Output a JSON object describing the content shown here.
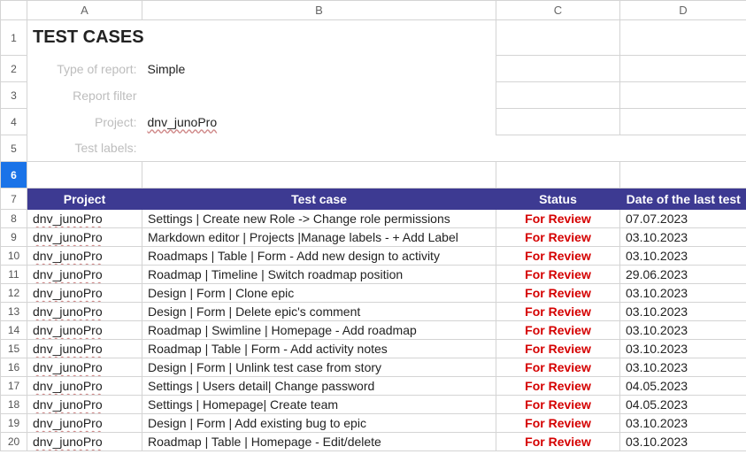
{
  "columns": [
    "A",
    "B",
    "C",
    "D"
  ],
  "top": {
    "title": "TEST CASES",
    "labels": {
      "type_of_report": "Type of report:",
      "report_filter": "Report filter",
      "project": "Project:",
      "test_labels": "Test labels:"
    },
    "values": {
      "type_of_report": "Simple",
      "report_filter": "",
      "project": "dnv_junoPro",
      "test_labels": ""
    }
  },
  "selected_row": 6,
  "table": {
    "headers": {
      "project": "Project",
      "test_case": "Test case",
      "status": "Status",
      "date": "Date of the last test"
    },
    "rows": [
      {
        "n": 8,
        "project": "dnv_junoPro",
        "test_case": "Settings | Create new Role -> Change role permissions",
        "status": "For Review",
        "date": "07.07.2023"
      },
      {
        "n": 9,
        "project": "dnv_junoPro",
        "test_case": "Markdown editor | Projects |Manage labels - + Add Label",
        "status": "For Review",
        "date": "03.10.2023"
      },
      {
        "n": 10,
        "project": "dnv_junoPro",
        "test_case": "Roadmaps | Table | Form - Add new  design  to activity",
        "status": "For Review",
        "date": "03.10.2023"
      },
      {
        "n": 11,
        "project": "dnv_junoPro",
        "test_case": "Roadmap | Timeline | Switch roadmap position",
        "status": "For Review",
        "date": "29.06.2023"
      },
      {
        "n": 12,
        "project": "dnv_junoPro",
        "test_case": "Design  | Form | Clone epic",
        "status": "For Review",
        "date": "03.10.2023"
      },
      {
        "n": 13,
        "project": "dnv_junoPro",
        "test_case": "Design  | Form | Delete epic's comment",
        "status": "For Review",
        "date": "03.10.2023"
      },
      {
        "n": 14,
        "project": "dnv_junoPro",
        "test_case": "Roadmap | Swimline | Homepage - Add roadmap",
        "status": "For Review",
        "date": "03.10.2023"
      },
      {
        "n": 15,
        "project": "dnv_junoPro",
        "test_case": "Roadmap | Table | Form - Add  activity notes",
        "status": "For Review",
        "date": "03.10.2023"
      },
      {
        "n": 16,
        "project": "dnv_junoPro",
        "test_case": "Design  | Form |  Unlink test case from story",
        "status": "For Review",
        "date": "03.10.2023"
      },
      {
        "n": 17,
        "project": "dnv_junoPro",
        "test_case": "Settings | Users detail| Change password",
        "status": "For Review",
        "date": "04.05.2023"
      },
      {
        "n": 18,
        "project": "dnv_junoPro",
        "test_case": "Settings | Homepage| Create team",
        "status": "For Review",
        "date": "04.05.2023"
      },
      {
        "n": 19,
        "project": "dnv_junoPro",
        "test_case": "Design  | Form |  Add existing bug to epic",
        "status": "For Review",
        "date": "03.10.2023"
      },
      {
        "n": 20,
        "project": "dnv_junoPro",
        "test_case": "Roadmap | Table | Homepage - Edit/delete",
        "status": "For Review",
        "date": "03.10.2023"
      }
    ]
  }
}
